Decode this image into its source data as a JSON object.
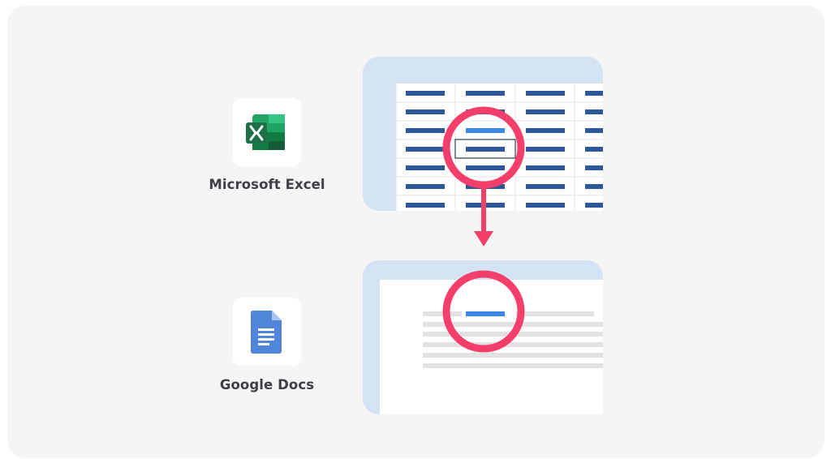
{
  "apps": {
    "excel": {
      "label": "Microsoft Excel",
      "icon": "microsoft-excel-icon"
    },
    "docs": {
      "label": "Google Docs",
      "icon": "google-docs-icon"
    }
  },
  "colors": {
    "background": "#f5f5f5",
    "panel_frame": "#d4e3f4",
    "cell_bar": "#2c579a",
    "highlight_bar": "#3d87e6",
    "doc_line": "#e2e2e2",
    "focus_ring": "#f43f6b",
    "label_text": "#3e4046",
    "excel_green": "#1e7145",
    "docs_blue": "#4f86d9"
  }
}
